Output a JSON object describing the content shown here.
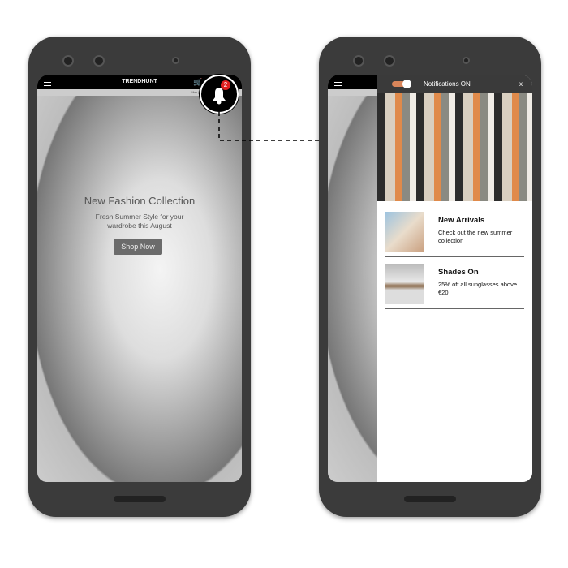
{
  "left_phone": {
    "brand": "TRENDHUNT",
    "nav": "Men | Women",
    "hero": {
      "title": "New Fashion Collection",
      "subtitle_line1": "Fresh Summer Style for your",
      "subtitle_line2": "wardrobe this August",
      "button": "Shop Now"
    },
    "notification_count": "2",
    "icons": [
      "menu-icon",
      "cart-icon",
      "bell-icon"
    ]
  },
  "right_phone": {
    "panel": {
      "header": "Notifications ON",
      "close": "x",
      "toggle_on": true,
      "toggle_color": "#d9855a",
      "items": [
        {
          "title": "New Arrivals",
          "text": "Check out the new summer collection"
        },
        {
          "title": "Shades On",
          "text": "25% off all sunglasses above €20"
        }
      ]
    }
  }
}
